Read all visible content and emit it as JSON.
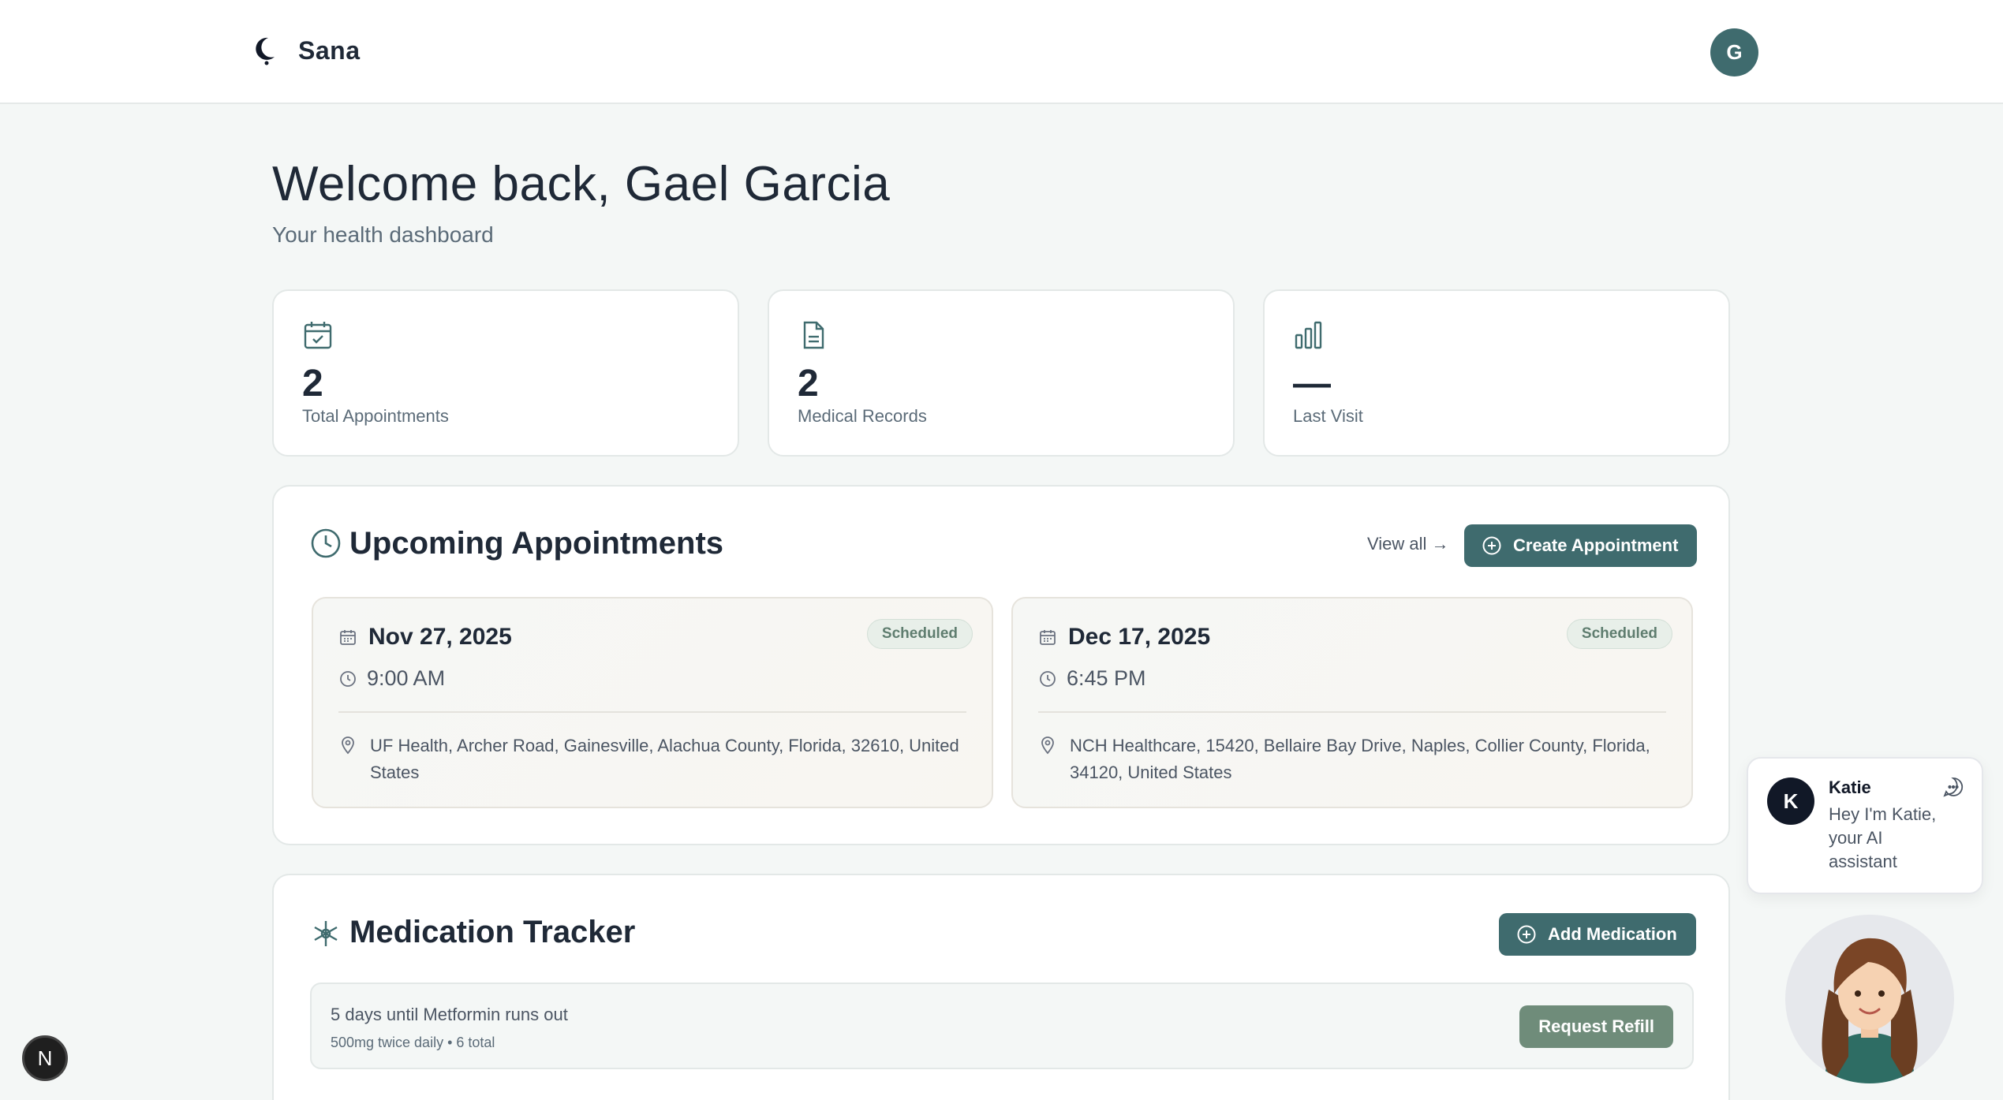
{
  "app": {
    "name": "Sana",
    "user_initial": "G"
  },
  "welcome": {
    "title": "Welcome back, Gael Garcia",
    "subtitle": "Your health dashboard"
  },
  "stats": [
    {
      "icon": "calendar-check-icon",
      "value": "2",
      "label": "Total Appointments"
    },
    {
      "icon": "document-icon",
      "value": "2",
      "label": "Medical Records"
    },
    {
      "icon": "bar-chart-icon",
      "value": "—",
      "label": "Last Visit"
    }
  ],
  "appointments": {
    "title": "Upcoming Appointments",
    "view_all": "View all →",
    "create_label": "Create Appointment",
    "items": [
      {
        "date": "Nov 27, 2025",
        "time": "9:00 AM",
        "status": "Scheduled",
        "location": "UF Health, Archer Road, Gainesville, Alachua County, Florida, 32610, United States"
      },
      {
        "date": "Dec 17, 2025",
        "time": "6:45 PM",
        "status": "Scheduled",
        "location": "NCH Healthcare, 15420, Bellaire Bay Drive, Naples, Collier County, Florida, 34120, United States"
      }
    ]
  },
  "medication": {
    "title": "Medication Tracker",
    "add_label": "Add Medication",
    "items": [
      {
        "main": "5 days until Metformin runs out",
        "sub": "500mg twice daily • 6 total",
        "action": "Request Refill"
      }
    ]
  },
  "assistant": {
    "initial": "K",
    "name": "Katie",
    "message": "Hey I'm Katie, your AI assistant"
  },
  "dev_badge": {
    "letter": "N"
  },
  "colors": {
    "accent": "#3f6b6e",
    "refill": "#6f8c7a",
    "background": "#f4f7f6"
  }
}
